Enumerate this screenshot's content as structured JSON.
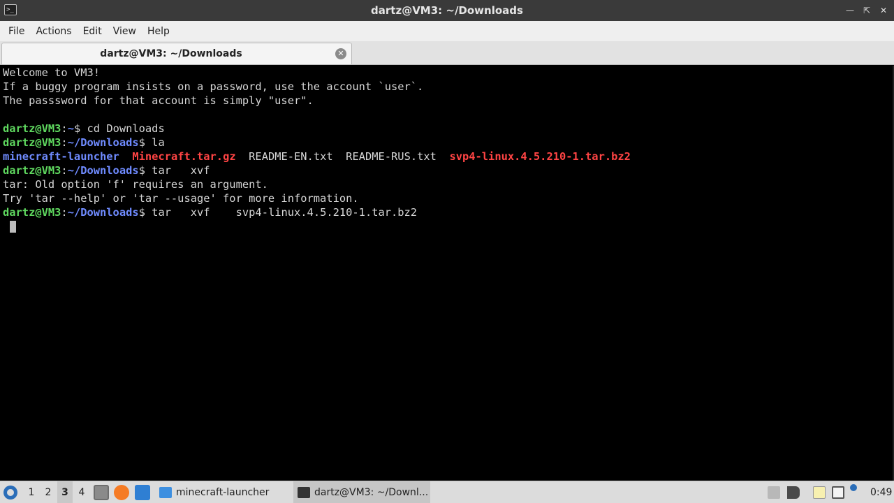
{
  "window": {
    "title": "dartz@VM3: ~/Downloads",
    "icon": "terminal-icon",
    "buttons": [
      "minimize-icon",
      "maximize-icon",
      "close-icon"
    ]
  },
  "menubar": {
    "file": "File",
    "actions": "Actions",
    "edit": "Edit",
    "view": "View",
    "help": "Help"
  },
  "tab": {
    "label": "dartz@VM3: ~/Downloads",
    "close_icon": "tab-close-icon"
  },
  "terminal": {
    "motd1": "Welcome to VM3!",
    "motd2": "If a buggy program insists on a password, use the account `user`.",
    "motd3": "The passsword for that account is simply \"user\".",
    "user": "dartz@VM3",
    "home": "~",
    "downloads": "~/Downloads",
    "cmd1": " cd Downloads",
    "cmd2": " la",
    "ls": {
      "f1": "minecraft-launcher",
      "f2": "Minecraft.tar.gz",
      "f3": "README-EN.txt",
      "f4": "README-RUS.txt",
      "f5": "svp4-linux.4.5.210-1.tar.bz2"
    },
    "cmd3": " tar   xvf",
    "err1": "tar: Old option 'f' requires an argument.",
    "err2": "Try 'tar --help' or 'tar --usage' for more information.",
    "cmd4": " tar   xvf    svp4-linux.4.5.210-1.tar.bz2"
  },
  "taskbar": {
    "workspaces": [
      "1",
      "2",
      "3",
      "4"
    ],
    "active_workspace": "3",
    "tasks": [
      {
        "label": "minecraft-launcher",
        "icon": "folder-icon"
      },
      {
        "label": "dartz@VM3: ~/Downl...",
        "icon": "terminal-icon"
      }
    ],
    "clock": "0:49"
  },
  "colors": {
    "prompt_user": "#5fd85f",
    "prompt_path": "#6f8bff",
    "archive": "#ff4444"
  }
}
